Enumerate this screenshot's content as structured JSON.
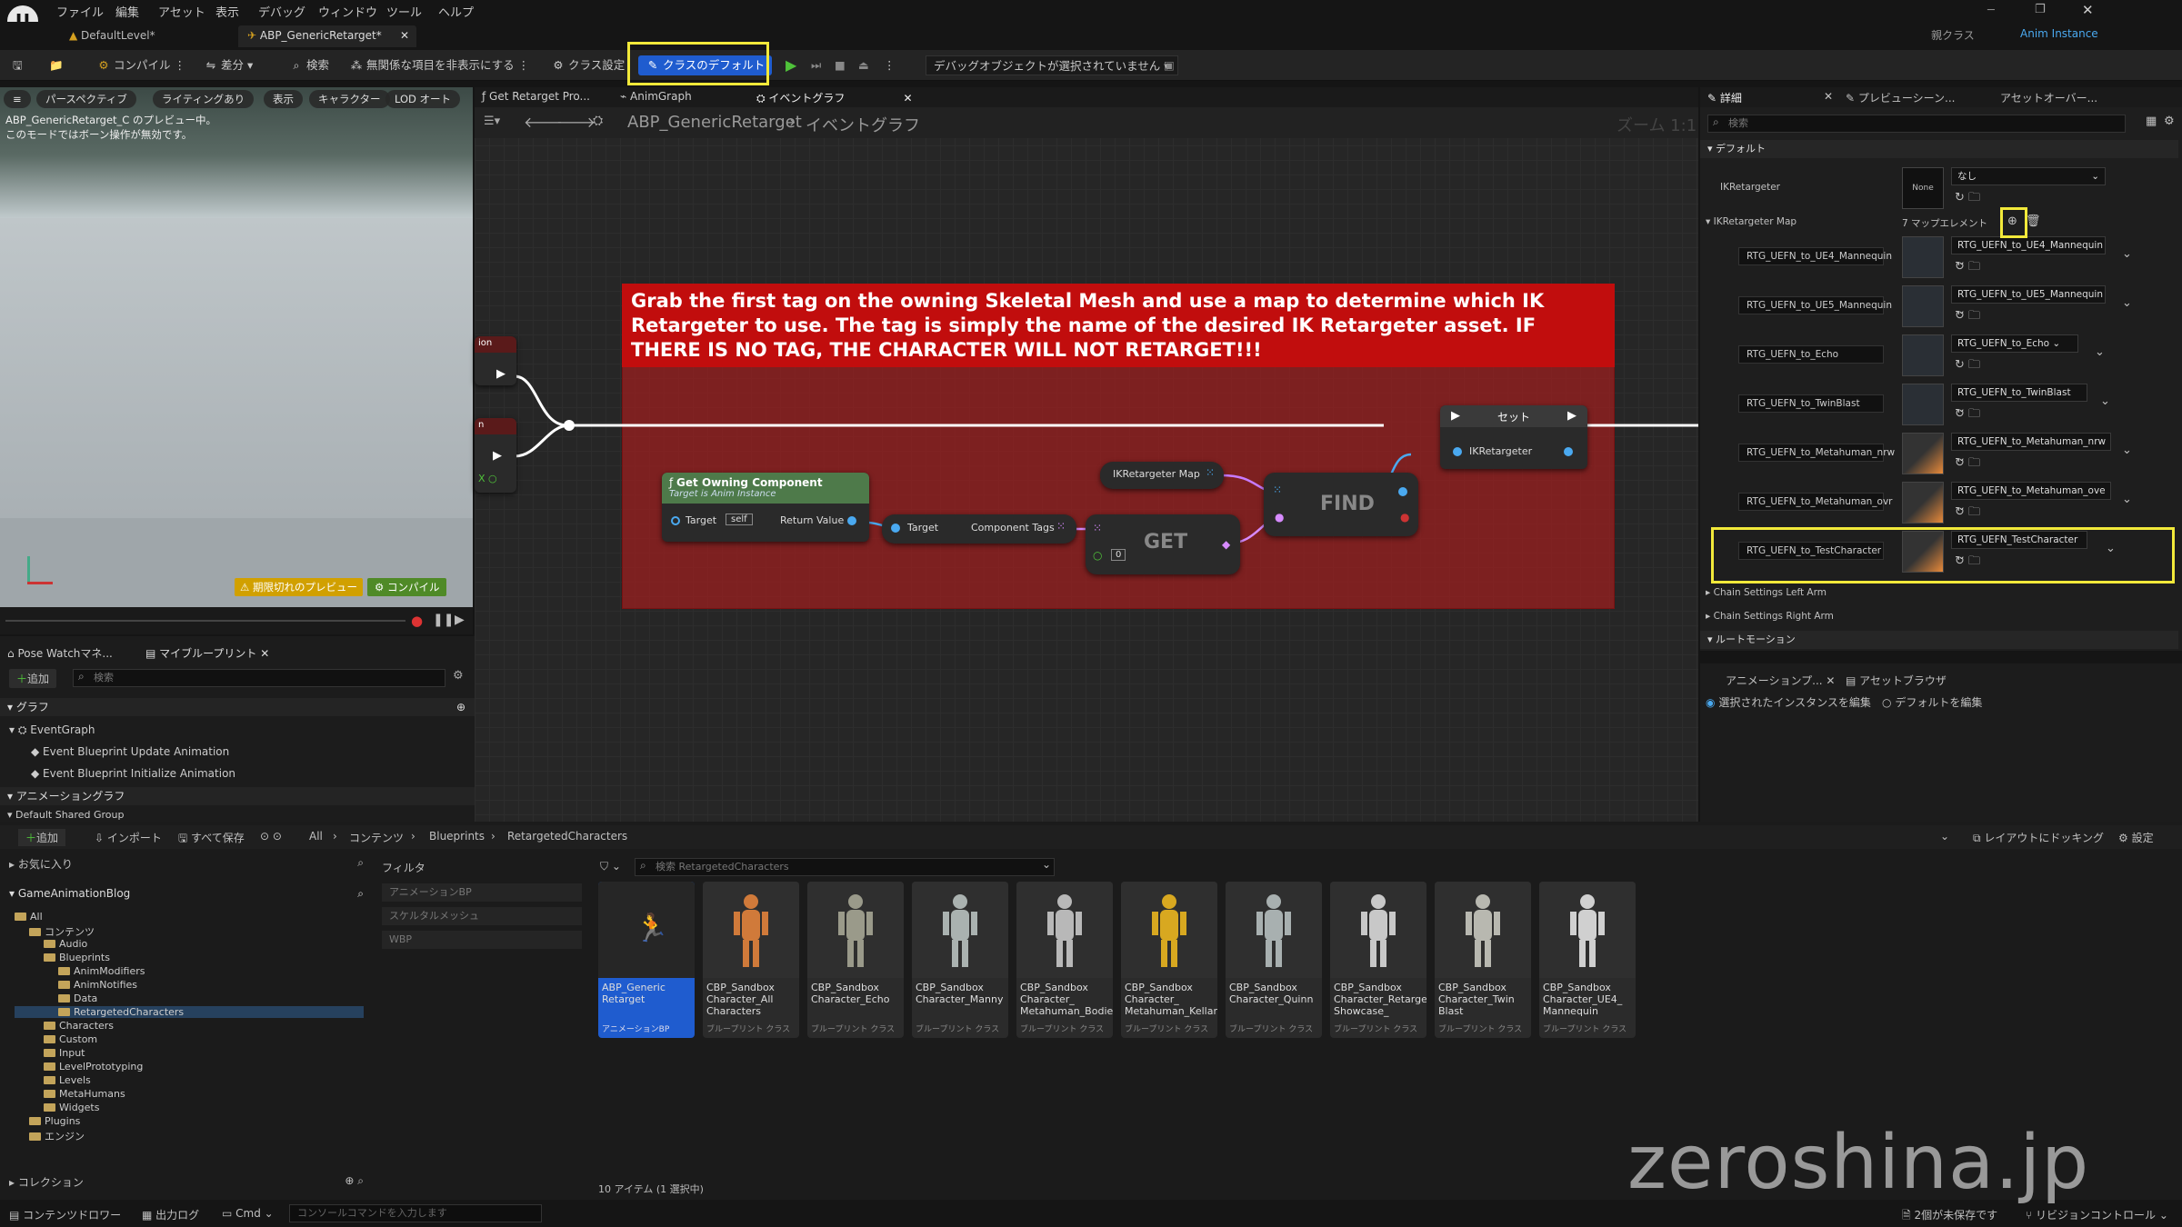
{
  "menu": {
    "items": [
      "ファイル",
      "編集",
      "アセット",
      "表示",
      "デバッグ",
      "ウィンドウ",
      "ツール",
      "ヘルプ"
    ],
    "parent_label": "親クラス",
    "parent_value": "Anim Instance"
  },
  "doc_tabs": [
    "DefaultLevel*",
    "ABP_GenericRetarget*"
  ],
  "toolbar": {
    "compile": "コンパイル",
    "diff": "差分",
    "search": "検索",
    "hide_unrelated": "無関係な項目を非表示にする",
    "class_settings": "クラス設定",
    "class_defaults": "クラスのデフォルト",
    "debug_object": "デバッグオブジェクトが選択されていません"
  },
  "viewport": {
    "buttons": [
      "パースペクティブ",
      "ライティングあり",
      "表示",
      "キャラクター",
      "LOD オート"
    ],
    "info_line1": "ABP_GenericRetarget_C のプレビュー中。",
    "info_line2": "このモードではボーン操作が無効です。",
    "preview_btn": "期限切れのプレビュー",
    "compile_btn": "コンパイル"
  },
  "left_tabs": {
    "pose_watch": "Pose Watchマネ...",
    "my_blueprint": "マイブループリント"
  },
  "my_blueprint": {
    "add": "追加",
    "search_placeholder": "検索",
    "graph_header": "グラフ",
    "event_graph": "EventGraph",
    "event1": "Event Blueprint Update Animation",
    "event2": "Event Blueprint Initialize Animation",
    "anim_graph_header": "アニメーショングラフ",
    "shared_group": "Default Shared Group"
  },
  "graph": {
    "tabs": [
      "Get Retarget Pro...",
      "AnimGraph",
      "イベントグラフ"
    ],
    "crumb_root": "ABP_GenericRetarget",
    "crumb_leaf": "イベントグラフ",
    "zoom": "ズーム 1:1",
    "comment": "Grab the first tag on the owning Skeletal Mesh and use a map to determine which IK Retargeter to use. The tag is simply the name of the desired IK Retargeter asset. IF THERE IS NO TAG, THE CHARACTER WILL NOT RETARGET!!!",
    "node_get_owning": "Get Owning Component",
    "node_get_owning_sub": "Target is Anim Instance",
    "pin_target": "Target",
    "pin_self": "self",
    "pin_return": "Return Value",
    "pin_target2": "Target",
    "pin_component_tags": "Component Tags",
    "node_get": "GET",
    "get_index": "0",
    "node_map": "IKRetargeter Map",
    "node_find": "FIND",
    "node_set": "セット",
    "pin_ikretargeter": "IKRetargeter",
    "stub1": "ion",
    "stub2": "n"
  },
  "details": {
    "tabs": [
      "詳細",
      "プレビューシーン...",
      "アセットオーバー..."
    ],
    "search_placeholder": "検索",
    "section_default": "デフォルト",
    "ikretargeter_label": "IKRetargeter",
    "ikretargeter_none": "None",
    "ikretargeter_value": "なし",
    "map_label": "IKRetargeter Map",
    "map_count": "7 マップエレメント",
    "rows": [
      {
        "key": "RTG_UEFN_to_UE4_Mannequin",
        "value": "RTG_UEFN_to_UE4_Mannequin"
      },
      {
        "key": "RTG_UEFN_to_UE5_Mannequin",
        "value": "RTG_UEFN_to_UE5_Mannequin"
      },
      {
        "key": "RTG_UEFN_to_Echo",
        "value": "RTG_UEFN_to_Echo"
      },
      {
        "key": "RTG_UEFN_to_TwinBlast",
        "value": "RTG_UEFN_to_TwinBlast"
      },
      {
        "key": "RTG_UEFN_to_Metahuman_nrw",
        "value": "RTG_UEFN_to_Metahuman_nrw"
      },
      {
        "key": "RTG_UEFN_to_Metahuman_ovr",
        "value": "RTG_UEFN_to_Metahuman_ove"
      },
      {
        "key": "RTG_UEFN_to_TestCharacter",
        "value": "RTG_UEFN_TestCharacter"
      }
    ],
    "chain_left": "Chain Settings Left Arm",
    "chain_right": "Chain Settings Right Arm",
    "root_motion": "ルートモーション"
  },
  "anim_panel": {
    "tab1": "アニメーションプ...",
    "tab2": "アセットブラウザ",
    "radio1": "選択されたインスタンスを編集",
    "radio2": "デフォルトを編集"
  },
  "content_browser": {
    "add": "追加",
    "import": "インポート",
    "save_all": "すべて保存",
    "crumbs": [
      "All",
      "コンテンツ",
      "Blueprints",
      "RetargetedCharacters"
    ],
    "dock": "レイアウトにドッキング",
    "settings": "設定",
    "favorites": "お気に入り",
    "project": "GameAnimationBlog",
    "filter": "フィルタ",
    "filters": [
      "アニメーションBP",
      "スケルタルメッシュ",
      "WBP"
    ],
    "search_placeholder": "検索 RetargetedCharacters",
    "collections": "コレクション",
    "count": "10 アイテム (1 選択中)",
    "tree": [
      {
        "label": "All",
        "indent": 0
      },
      {
        "label": "コンテンツ",
        "indent": 1
      },
      {
        "label": "Audio",
        "indent": 2
      },
      {
        "label": "Blueprints",
        "indent": 2
      },
      {
        "label": "AnimModifiers",
        "indent": 3
      },
      {
        "label": "AnimNotifies",
        "indent": 3
      },
      {
        "label": "Data",
        "indent": 3
      },
      {
        "label": "RetargetedCharacters",
        "indent": 3
      },
      {
        "label": "Characters",
        "indent": 2
      },
      {
        "label": "Custom",
        "indent": 2
      },
      {
        "label": "Input",
        "indent": 2
      },
      {
        "label": "LevelPrototyping",
        "indent": 2
      },
      {
        "label": "Levels",
        "indent": 2
      },
      {
        "label": "MetaHumans",
        "indent": 2
      },
      {
        "label": "Widgets",
        "indent": 2
      },
      {
        "label": "Plugins",
        "indent": 1
      },
      {
        "label": "エンジン",
        "indent": 1
      }
    ],
    "assets": [
      {
        "name": "ABP_Generic Retarget",
        "type": "アニメーションBP"
      },
      {
        "name": "CBP_Sandbox Character_All Characters",
        "type": "ブループリント クラス"
      },
      {
        "name": "CBP_Sandbox Character_Echo",
        "type": "ブループリント クラス"
      },
      {
        "name": "CBP_Sandbox Character_Manny",
        "type": "ブループリント クラス"
      },
      {
        "name": "CBP_Sandbox Character_ Metahuman_Bodies",
        "type": "ブループリント クラス"
      },
      {
        "name": "CBP_Sandbox Character_ Metahuman_Kellan",
        "type": "ブループリント クラス"
      },
      {
        "name": "CBP_Sandbox Character_Quinn",
        "type": "ブループリント クラス"
      },
      {
        "name": "CBP_Sandbox Character_Retarget Showcase_",
        "type": "ブループリント クラス"
      },
      {
        "name": "CBP_Sandbox Character_Twin Blast",
        "type": "ブループリント クラス"
      },
      {
        "name": "CBP_Sandbox Character_UE4_ Mannequin",
        "type": "ブループリント クラス"
      }
    ]
  },
  "status": {
    "content_drawer": "コンテンツドロワー",
    "output_log": "出力ログ",
    "cmd": "Cmd",
    "console_placeholder": "コンソールコマンドを入力します",
    "unsaved": "2個が未保存です",
    "revision": "リビジョンコントロール"
  },
  "watermark": "zeroshina.jp"
}
